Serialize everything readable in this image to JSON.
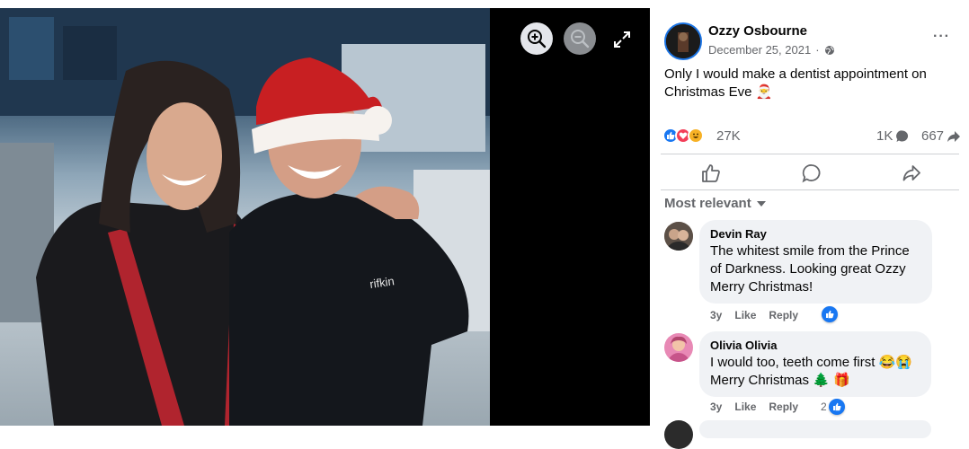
{
  "post": {
    "author": "Ozzy Osbourne",
    "date": "December 25, 2021",
    "date_separator": "·",
    "more": "···",
    "text": "Only I would make a dentist appointment on Christmas Eve 🎅",
    "reaction_count": "27K",
    "comment_count": "1K",
    "share_count": "667"
  },
  "photo": {
    "shirt_text": "rifkin"
  },
  "comments_header": {
    "sort_label": "Most relevant"
  },
  "comments": [
    {
      "name": "Devin Ray",
      "text": "The whitest smile from the Prince of Darkness. Looking great Ozzy Merry Christmas!",
      "age": "3y",
      "like": "Like",
      "reply": "Reply",
      "reaction_count": ""
    },
    {
      "name": "Olivia Olivia",
      "text": "I would too, teeth come first 😂😭 Merry Christmas 🌲 🎁",
      "age": "3y",
      "like": "Like",
      "reply": "Reply",
      "reaction_count": "2"
    }
  ],
  "colors": {
    "accent": "#1877f2",
    "secondary_text": "#65676b",
    "bubble": "#f0f2f5",
    "love": "#f33e58",
    "haha": "#f7b125"
  },
  "icons": [
    "zoom-in-icon",
    "zoom-out-icon",
    "expand-icon",
    "globe-icon",
    "more-icon",
    "like-icon",
    "comment-icon",
    "share-icon",
    "chevron-down-icon"
  ]
}
